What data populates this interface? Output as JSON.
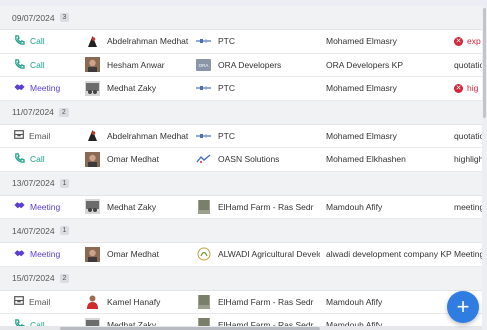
{
  "groups": [
    {
      "date": "09/07/2024",
      "count": "3",
      "rows": [
        {
          "type": "Call",
          "type_kind": "call",
          "contact": "Abdelrahman Medhat Zaky",
          "avatar": "silhouette",
          "org": "PTC",
          "org_logo": "ptc",
          "deal": "Mohamed Elmasry",
          "subject": "exp",
          "subject_style": "red-status"
        },
        {
          "type": "Call",
          "type_kind": "call",
          "contact": "Hesham Anwar",
          "avatar": "photo",
          "org": "ORA Developers",
          "org_logo": "ora",
          "deal": "ORA Developers KP",
          "subject": "quotatio",
          "subject_style": "plain"
        },
        {
          "type": "Meeting",
          "type_kind": "meeting",
          "contact": "Medhat Zaky",
          "avatar": "group",
          "org": "PTC",
          "org_logo": "ptc",
          "deal": "Mohamed Elmasry",
          "subject": "hig",
          "subject_style": "red-status"
        }
      ]
    },
    {
      "date": "11/07/2024",
      "count": "2",
      "rows": [
        {
          "type": "Email",
          "type_kind": "email",
          "contact": "Abdelrahman Medhat Zaky",
          "avatar": "silhouette",
          "org": "PTC",
          "org_logo": "ptc",
          "deal": "Mohamed Elmasry",
          "subject": "quotatio",
          "subject_style": "plain"
        },
        {
          "type": "Call",
          "type_kind": "call",
          "contact": "Omar Medhat",
          "avatar": "photo",
          "org": "OASN Solutions",
          "org_logo": "oasn",
          "deal": "Mohamed Elkhashen",
          "subject": "highligh",
          "subject_style": "plain"
        }
      ]
    },
    {
      "date": "13/07/2024",
      "count": "1",
      "rows": [
        {
          "type": "Meeting",
          "type_kind": "meeting",
          "contact": "Medhat Zaky",
          "avatar": "group",
          "org": "ElHamd Farm - Ras Sedr",
          "org_logo": "farm",
          "deal": "Mamdouh Afify",
          "subject": "meeting",
          "subject_style": "plain"
        }
      ]
    },
    {
      "date": "14/07/2024",
      "count": "1",
      "rows": [
        {
          "type": "Meeting",
          "type_kind": "meeting",
          "contact": "Omar Medhat",
          "avatar": "photo",
          "org": "ALWADI Agricultural Development",
          "org_logo": "alwadi",
          "deal": "alwadi development company KP",
          "subject": "Meeting",
          "subject_style": "plain"
        }
      ]
    },
    {
      "date": "15/07/2024",
      "count": "2",
      "rows": [
        {
          "type": "Email",
          "type_kind": "email",
          "contact": "Kamel Hanafy",
          "avatar": "person-red",
          "org": "ElHamd Farm - Ras Sedr",
          "org_logo": "farm",
          "deal": "Mamdouh Afify",
          "subject": "",
          "subject_style": "plain"
        },
        {
          "type": "Call",
          "type_kind": "call",
          "contact": "Medhat Zaky",
          "avatar": "group",
          "org": "ElHamd Farm - Ras Sedr",
          "org_logo": "farm",
          "deal": "Mamdouh Afify",
          "subject": "",
          "subject_style": "plain"
        }
      ]
    }
  ],
  "fab": {
    "label": "+"
  },
  "colors": {
    "call": "#1aa38a",
    "meeting": "#5b3fd1",
    "email": "#555555",
    "accent": "#2f7de1",
    "status_red": "#d3263a"
  }
}
